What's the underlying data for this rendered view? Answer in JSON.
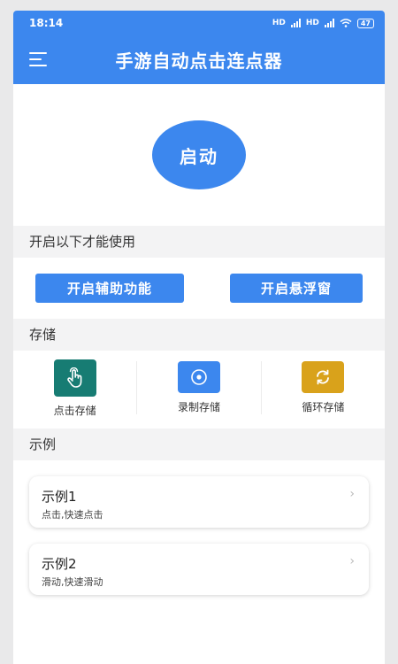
{
  "status": {
    "time": "18:14",
    "battery": "47",
    "net1": "HD",
    "net2": "HD"
  },
  "appbar": {
    "title": "手游自动点击连点器"
  },
  "start": {
    "label": "启动"
  },
  "section1": {
    "title": "开启以下才能使用"
  },
  "buttons": {
    "accessibility": "开启辅助功能",
    "floating": "开启悬浮窗"
  },
  "section2": {
    "title": "存储"
  },
  "storage": [
    {
      "label": "点击存储",
      "color": "#177c73",
      "icon": "tap-hand-icon"
    },
    {
      "label": "录制存储",
      "color": "#3c87ee",
      "icon": "record-icon"
    },
    {
      "label": "循环存储",
      "color": "#d9a21b",
      "icon": "loop-icon"
    }
  ],
  "section3": {
    "title": "示例"
  },
  "examples": [
    {
      "title": "示例1",
      "subtitle": "点击,快速点击"
    },
    {
      "title": "示例2",
      "subtitle": "滑动,快速滑动"
    }
  ],
  "colors": {
    "primary": "#3c87ee"
  }
}
